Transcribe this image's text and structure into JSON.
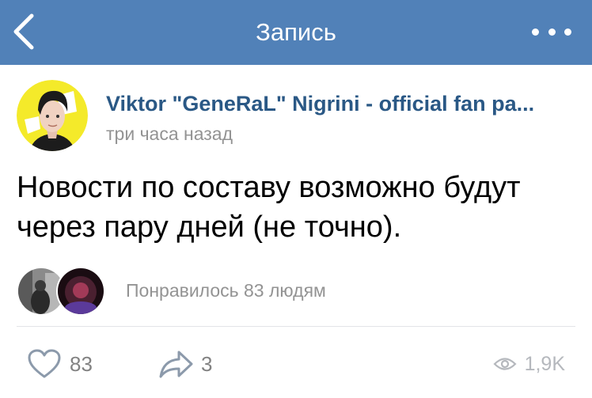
{
  "header": {
    "title": "Запись",
    "back_icon": "chevron-left-icon",
    "more_icon": "more-dots-icon"
  },
  "post": {
    "author": "Viktor \"GeneRaL\" Nigrini - official fan pa...",
    "time": "три часа назад",
    "text": "Новости по составу возможно будут через пару дней (не точно).",
    "likes_summary": "Понравилось 83 людям"
  },
  "actions": {
    "likes": "83",
    "reposts": "3",
    "views": "1,9K"
  },
  "colors": {
    "header_bg": "#5181b8",
    "link": "#2a5885",
    "muted": "#939393"
  }
}
